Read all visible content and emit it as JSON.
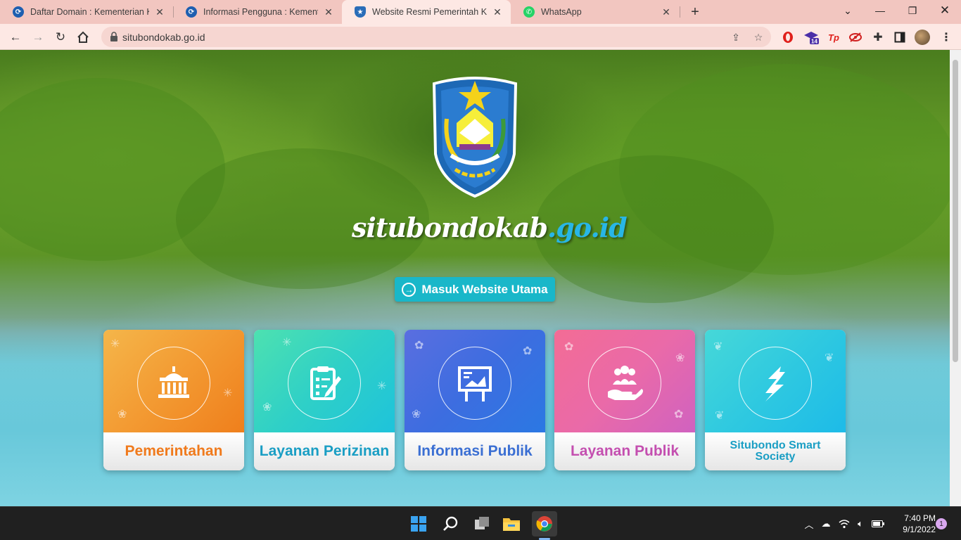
{
  "browser": {
    "tabs": [
      {
        "title": "Daftar Domain : Kementerian Kor",
        "active": false,
        "icon": "kominfo-favicon"
      },
      {
        "title": "Informasi Pengguna : Kementeria",
        "active": false,
        "icon": "kominfo-favicon"
      },
      {
        "title": "Website Resmi Pemerintah Kabup",
        "active": true,
        "icon": "situbondo-crest-favicon"
      },
      {
        "title": "WhatsApp",
        "active": false,
        "icon": "whatsapp-favicon"
      }
    ],
    "url": "situbondokab.go.id",
    "extension_badge": "14",
    "extension_tp": "Tp"
  },
  "page": {
    "brand_main": "situbondokab",
    "brand_domain": ".go.id",
    "enter_button": "Masuk Website Utama",
    "cards": [
      {
        "label": "Pemerintahan",
        "color": "#f07a1c",
        "icon": "government-building-icon"
      },
      {
        "label": "Layanan Perizinan",
        "color": "#1a9ec4",
        "icon": "clipboard-checklist-icon"
      },
      {
        "label": "Informasi Publik",
        "color": "#3b6fd3",
        "icon": "presentation-board-icon"
      },
      {
        "label": "Layanan Publik",
        "color": "#c44fb0",
        "icon": "hands-people-icon"
      },
      {
        "label": "Situbondo Smart Society",
        "color": "#1a9ec4",
        "icon": "smart-society-s-icon"
      }
    ]
  },
  "taskbar": {
    "time": "7:40 PM",
    "date": "9/1/2022",
    "notifications": "1"
  }
}
